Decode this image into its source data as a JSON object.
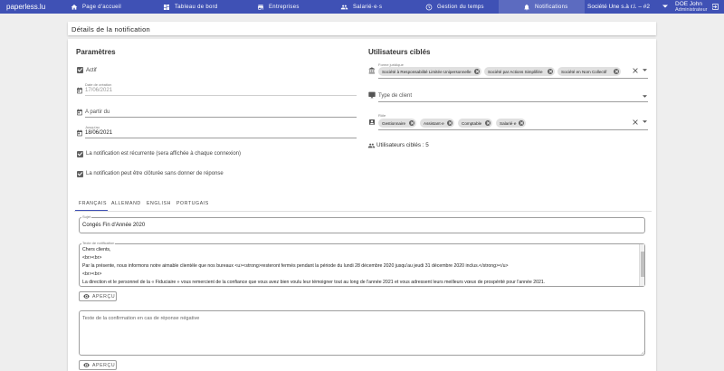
{
  "nav": {
    "brand": "paperless.lu",
    "items": [
      {
        "label": "Page d'accueil",
        "icon": "home-icon"
      },
      {
        "label": "Tableau de bord",
        "icon": "dashboard-icon"
      },
      {
        "label": "Entreprises",
        "icon": "business-icon"
      },
      {
        "label": "Salarié·e·s",
        "icon": "people-icon"
      },
      {
        "label": "Gestion du temps",
        "icon": "clock-icon"
      },
      {
        "label": "Notifications",
        "icon": "bell-icon"
      }
    ],
    "company": "Société Une s.à r.l. – #2",
    "user_name": "DOE John",
    "user_role": "Administrateur"
  },
  "page": {
    "title": "Détails de la notification"
  },
  "params": {
    "title": "Paramètres",
    "actif_label": "Actif",
    "creation_label": "Date de création",
    "creation_value": "17/06/2021",
    "from_label": "A partir du",
    "until_label": "Jusqu'au",
    "until_value": "18/06/2021",
    "recurring_label": "La notification est récurrente (sera affichée à chaque connexion)",
    "close_label": "La notification peut être clôturée sans donner de réponse"
  },
  "targets": {
    "title": "Utilisateurs ciblés",
    "legal_label": "Forme juridique",
    "legal_chips": [
      "Société à Responsabilité Limitée Unipersonnelle",
      "Société par Actions Simplifiée",
      "Société en Nom Collectif"
    ],
    "client_type_placeholder": "Type de client",
    "role_label": "Rôle",
    "role_chips": [
      "Gestionnaire",
      "Assistant·e",
      "Comptable",
      "Salarié·e"
    ],
    "count_text": "Utilisateurs ciblés : 5"
  },
  "tabs": [
    "FRANÇAIS",
    "ALLEMAND",
    "ENGLISH",
    "PORTUGAIS"
  ],
  "subject": {
    "label": "Sujet",
    "value": "Congés Fin d'Année 2020"
  },
  "notif_text": {
    "label": "Texte de notification",
    "lines": [
      "Chers clients,",
      "<br><br>",
      "Par la présente, nous informons notre aimable clientèle que nos bureaux <u><strong>resteront fermés pendant la période du lundi 28 décembre 2020 jusqu'au jeudi 31 décembre 2020 inclus.</strong></u>",
      "<br><br>",
      "La direction et le personnel de la « Fiduciaire » vous remercient de la confiance que vous avez bien voulu leur témoigner tout au long de l'année 2021 et vous adressent leurs meilleurs vœux de prospérité pour l'année 2021."
    ]
  },
  "preview_label": "APERÇU",
  "negative": {
    "placeholder": "Texte de la confirmation en cas de réponse négative"
  }
}
